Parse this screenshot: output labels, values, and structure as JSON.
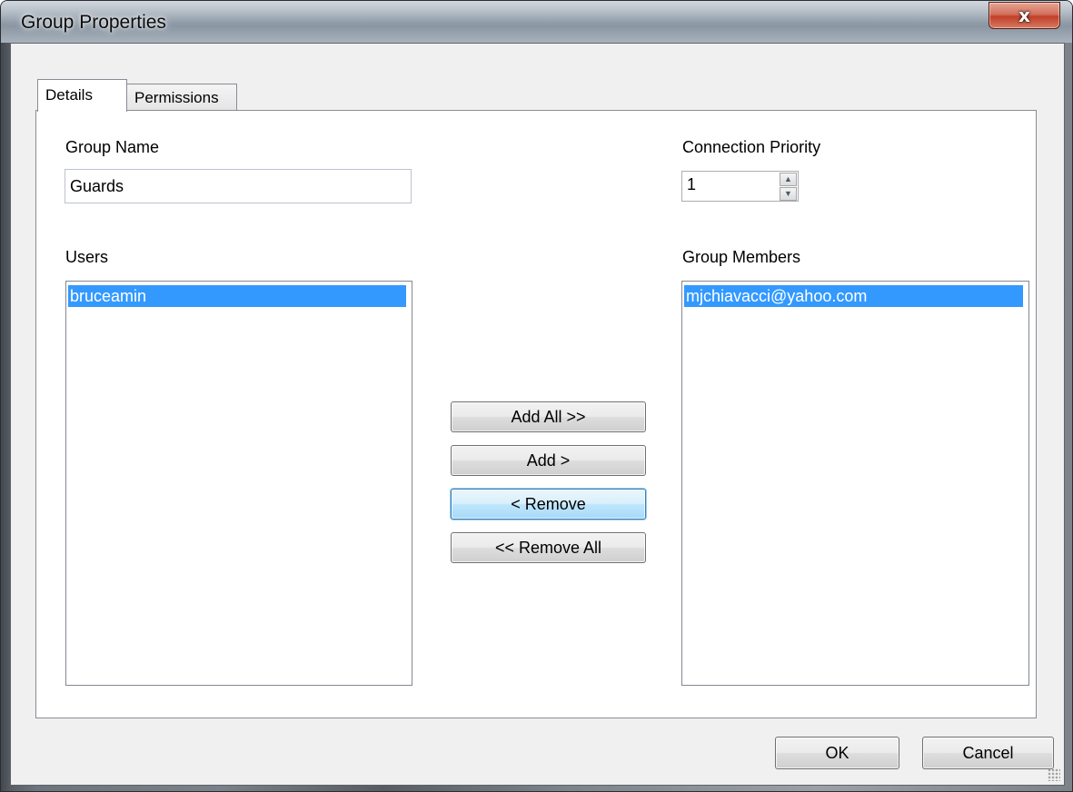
{
  "window": {
    "title": "Group Properties",
    "close_glyph": "x"
  },
  "tabs": [
    {
      "label": "Details",
      "selected": true
    },
    {
      "label": "Permissions",
      "selected": false
    }
  ],
  "details": {
    "group_name_label": "Group Name",
    "group_name_value": "Guards",
    "connection_priority_label": "Connection Priority",
    "connection_priority_value": "1",
    "users_label": "Users",
    "users": [
      "bruceamin"
    ],
    "group_members_label": "Group Members",
    "group_members": [
      "mjchiavacci@yahoo.com"
    ]
  },
  "transfer_buttons": {
    "add_all": "Add All >>",
    "add": "Add >",
    "remove": "< Remove",
    "remove_all": "<< Remove All"
  },
  "footer": {
    "ok": "OK",
    "cancel": "Cancel"
  },
  "icons": {
    "spin_up": "arrow-up-icon",
    "spin_down": "arrow-down-icon",
    "close": "close-icon",
    "size_grip": "resize-grip-icon"
  },
  "colors": {
    "selection": "#3399ff",
    "close_button": "#c2402a",
    "focus_button": "#bee6fd"
  }
}
